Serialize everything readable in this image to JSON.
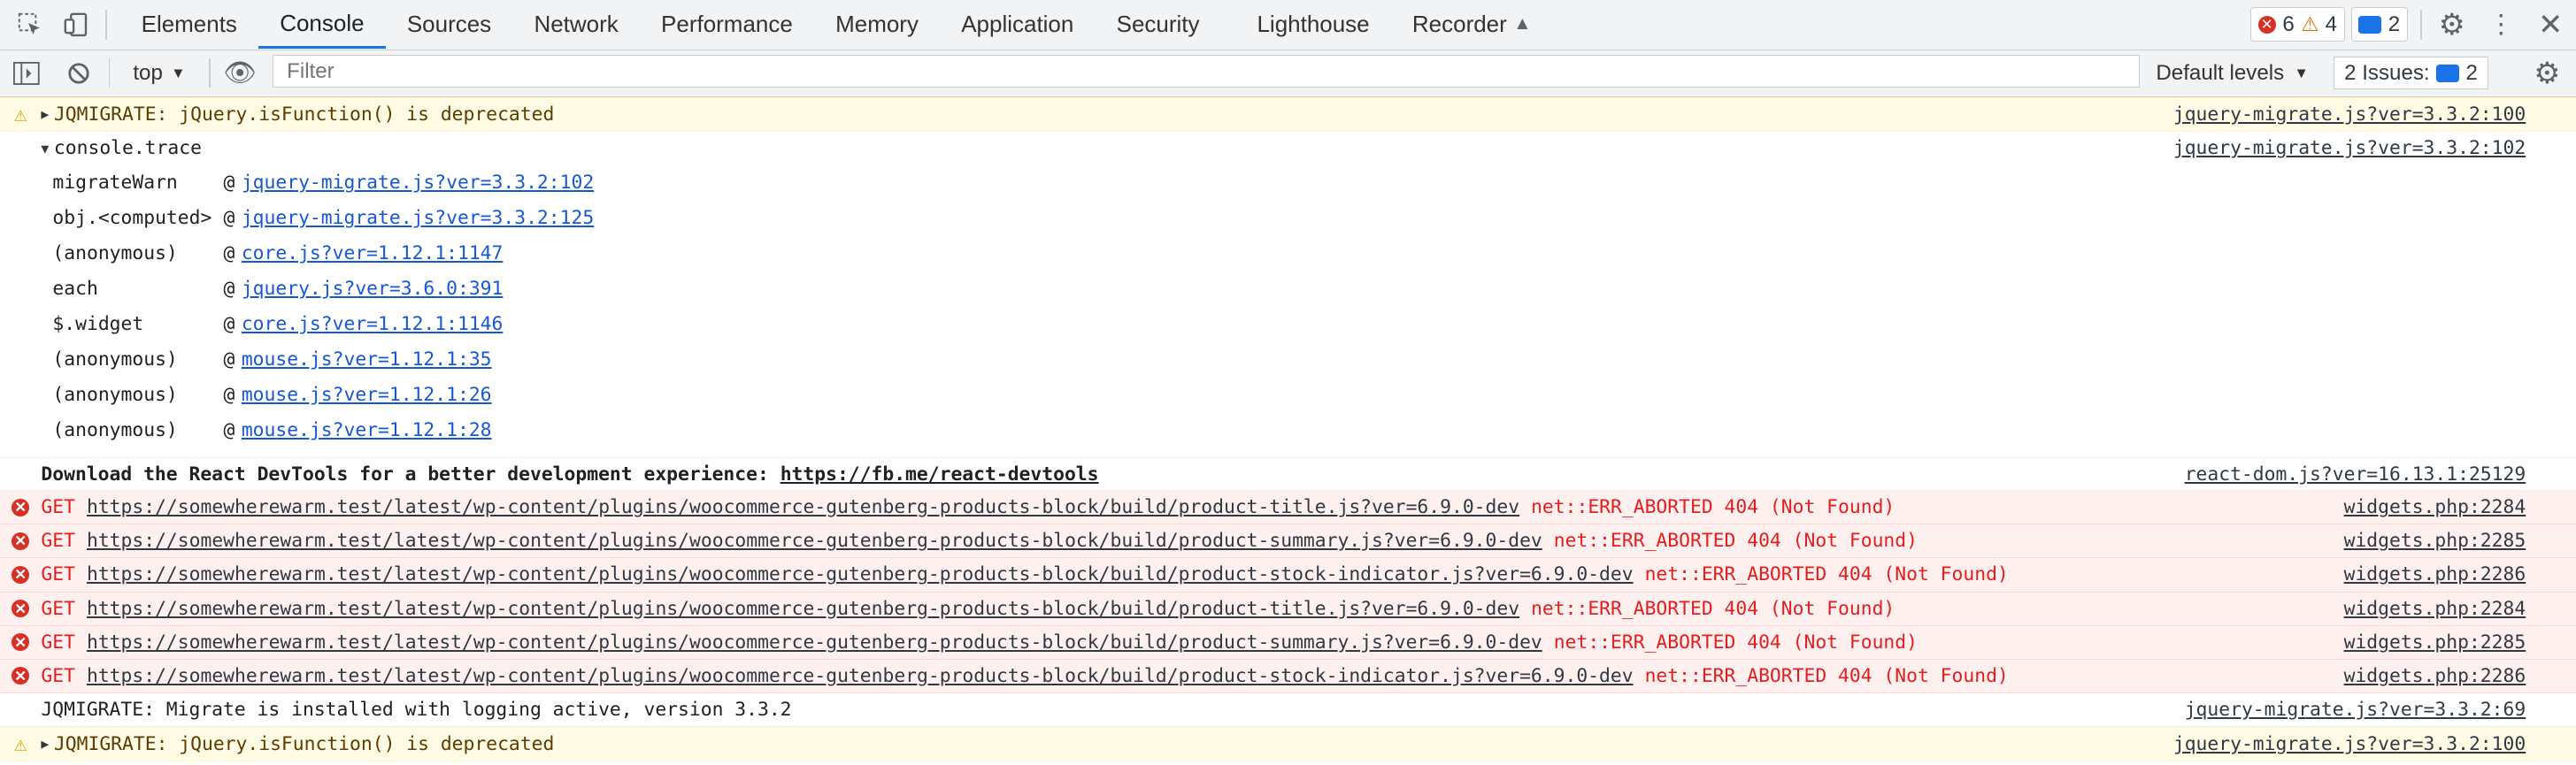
{
  "tabs": [
    "Elements",
    "Console",
    "Sources",
    "Network",
    "Performance",
    "Memory",
    "Application",
    "Security",
    "Lighthouse",
    "Recorder"
  ],
  "active_tab": "Console",
  "counters": {
    "errors": "6",
    "warnings": "4",
    "info": "2"
  },
  "toolbar": {
    "context": "top",
    "filter_placeholder": "Filter",
    "levels": "Default levels",
    "issues_label": "2 Issues:",
    "issues_count": "2"
  },
  "messages": {
    "m1": {
      "text": "JQMIGRATE: jQuery.isFunction() is deprecated",
      "src": "jquery-migrate.js?ver=3.3.2:100"
    },
    "trace": {
      "title": "console.trace",
      "src": "jquery-migrate.js?ver=3.3.2:102",
      "frames": [
        {
          "fn": "migrateWarn",
          "link": "jquery-migrate.js?ver=3.3.2:102"
        },
        {
          "fn": "obj.<computed>",
          "link": "jquery-migrate.js?ver=3.3.2:125"
        },
        {
          "fn": "(anonymous)",
          "link": "core.js?ver=1.12.1:1147"
        },
        {
          "fn": "each",
          "link": "jquery.js?ver=3.6.0:391"
        },
        {
          "fn": "$.widget",
          "link": "core.js?ver=1.12.1:1146"
        },
        {
          "fn": "(anonymous)",
          "link": "mouse.js?ver=1.12.1:35"
        },
        {
          "fn": "(anonymous)",
          "link": "mouse.js?ver=1.12.1:26"
        },
        {
          "fn": "(anonymous)",
          "link": "mouse.js?ver=1.12.1:28"
        }
      ]
    },
    "react": {
      "text": "Download the React DevTools for a better development experience: ",
      "url": "https://fb.me/react-devtools",
      "src": "react-dom.js?ver=16.13.1:25129"
    },
    "errors": [
      {
        "method": "GET",
        "url": "https://somewherewarm.test/latest/wp-content/plugins/woocommerce-gutenberg-products-block/build/product-title.js?ver=6.9.0-dev",
        "status": "net::ERR_ABORTED 404 (Not Found)",
        "src": "widgets.php:2284"
      },
      {
        "method": "GET",
        "url": "https://somewherewarm.test/latest/wp-content/plugins/woocommerce-gutenberg-products-block/build/product-summary.js?ver=6.9.0-dev",
        "status": "net::ERR_ABORTED 404 (Not Found)",
        "src": "widgets.php:2285"
      },
      {
        "method": "GET",
        "url": "https://somewherewarm.test/latest/wp-content/plugins/woocommerce-gutenberg-products-block/build/product-stock-indicator.js?ver=6.9.0-dev",
        "status": "net::ERR_ABORTED 404 (Not Found)",
        "src": "widgets.php:2286"
      },
      {
        "method": "GET",
        "url": "https://somewherewarm.test/latest/wp-content/plugins/woocommerce-gutenberg-products-block/build/product-title.js?ver=6.9.0-dev",
        "status": "net::ERR_ABORTED 404 (Not Found)",
        "src": "widgets.php:2284"
      },
      {
        "method": "GET",
        "url": "https://somewherewarm.test/latest/wp-content/plugins/woocommerce-gutenberg-products-block/build/product-summary.js?ver=6.9.0-dev",
        "status": "net::ERR_ABORTED 404 (Not Found)",
        "src": "widgets.php:2285"
      },
      {
        "method": "GET",
        "url": "https://somewherewarm.test/latest/wp-content/plugins/woocommerce-gutenberg-products-block/build/product-stock-indicator.js?ver=6.9.0-dev",
        "status": "net::ERR_ABORTED 404 (Not Found)",
        "src": "widgets.php:2286"
      }
    ],
    "m_info": {
      "text": "JQMIGRATE: Migrate is installed with logging active, version 3.3.2",
      "src": "jquery-migrate.js?ver=3.3.2:69"
    },
    "m_last": {
      "text": "JQMIGRATE: jQuery.isFunction() is deprecated",
      "src": "jquery-migrate.js?ver=3.3.2:100"
    }
  }
}
